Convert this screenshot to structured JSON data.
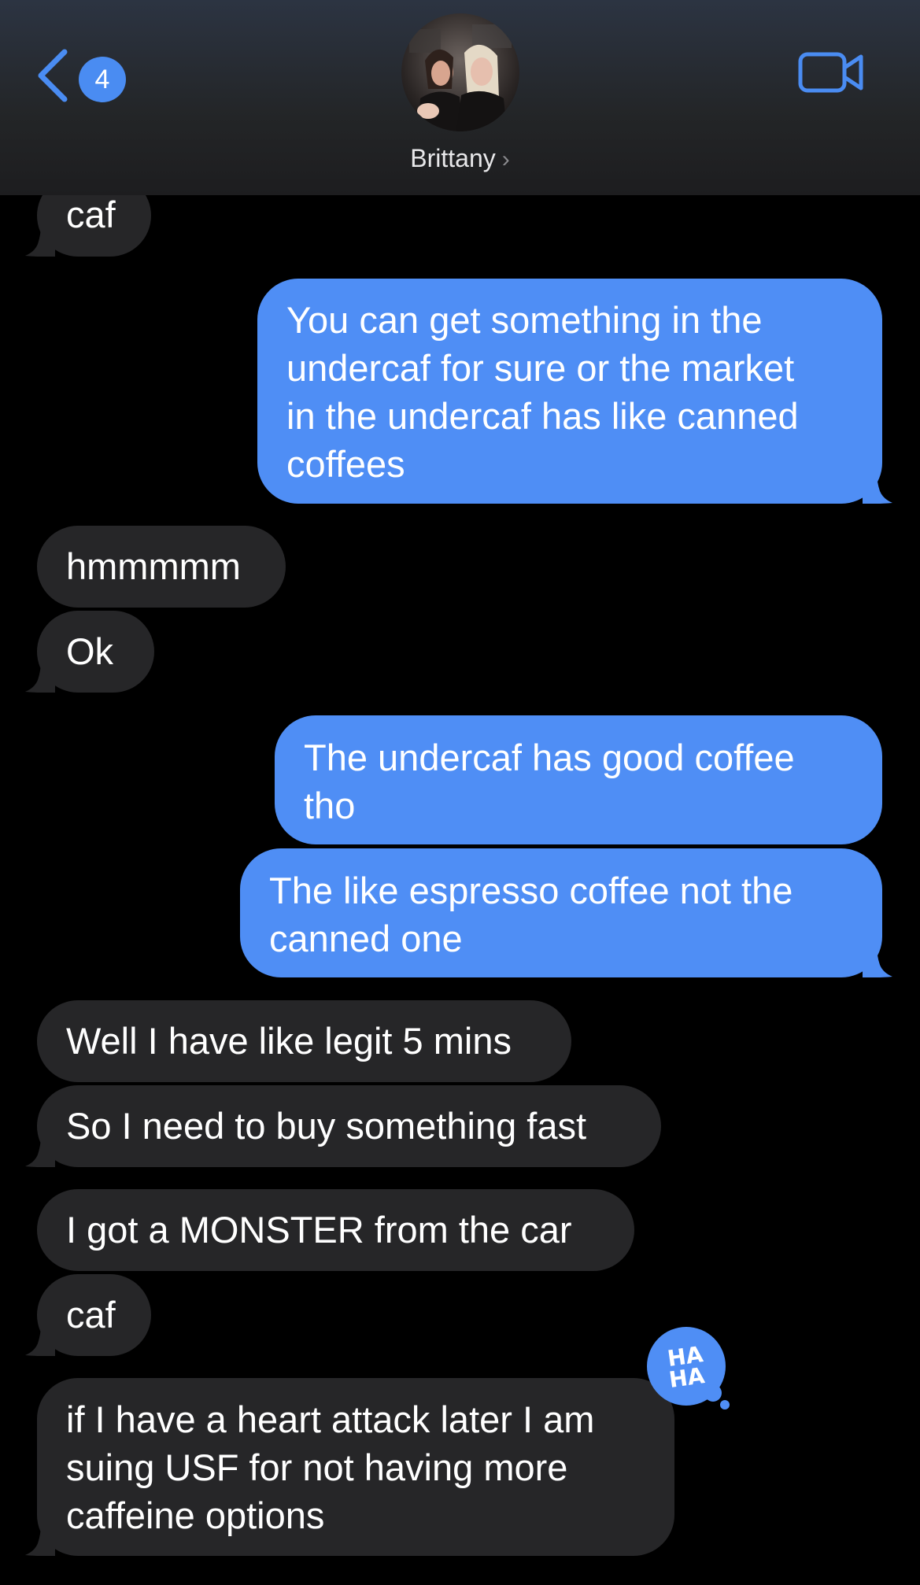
{
  "header": {
    "back_badge": "4",
    "contact_name": "Brittany",
    "chevron": "›",
    "video_icon": "video-camera-icon"
  },
  "messages": [
    {
      "id": "m0",
      "direction": "in",
      "text": "caf"
    },
    {
      "id": "m1",
      "direction": "out",
      "lines": [
        "You can get something in the",
        "undercaf for sure or the market",
        "in the undercaf has like canned",
        "coffees"
      ]
    },
    {
      "id": "m2",
      "direction": "in",
      "text": "hmmmmm"
    },
    {
      "id": "m3",
      "direction": "in",
      "text": "Ok"
    },
    {
      "id": "m4",
      "direction": "out",
      "lines": [
        "The undercaf has good coffee",
        "tho"
      ]
    },
    {
      "id": "m5",
      "direction": "out",
      "lines": [
        "The like espresso coffee not the",
        "canned one"
      ]
    },
    {
      "id": "m6",
      "direction": "in",
      "text": "Well I have like legit 5 mins"
    },
    {
      "id": "m7",
      "direction": "in",
      "text": "So I need to buy something fast"
    },
    {
      "id": "m8",
      "direction": "in",
      "text": "I got a MONSTER from the car"
    },
    {
      "id": "m9",
      "direction": "in",
      "text": "caf"
    },
    {
      "id": "m10",
      "direction": "in",
      "lines": [
        "if I have a heart attack later I am",
        "suing USF for not having more",
        "caffeine options"
      ]
    }
  ],
  "reaction": {
    "label_top": "HA",
    "label_bottom": "HA",
    "color": "#4f8ef5"
  },
  "colors": {
    "incoming": "#262628",
    "outgoing": "#4f8ef5",
    "accent": "#4a8cf2"
  }
}
